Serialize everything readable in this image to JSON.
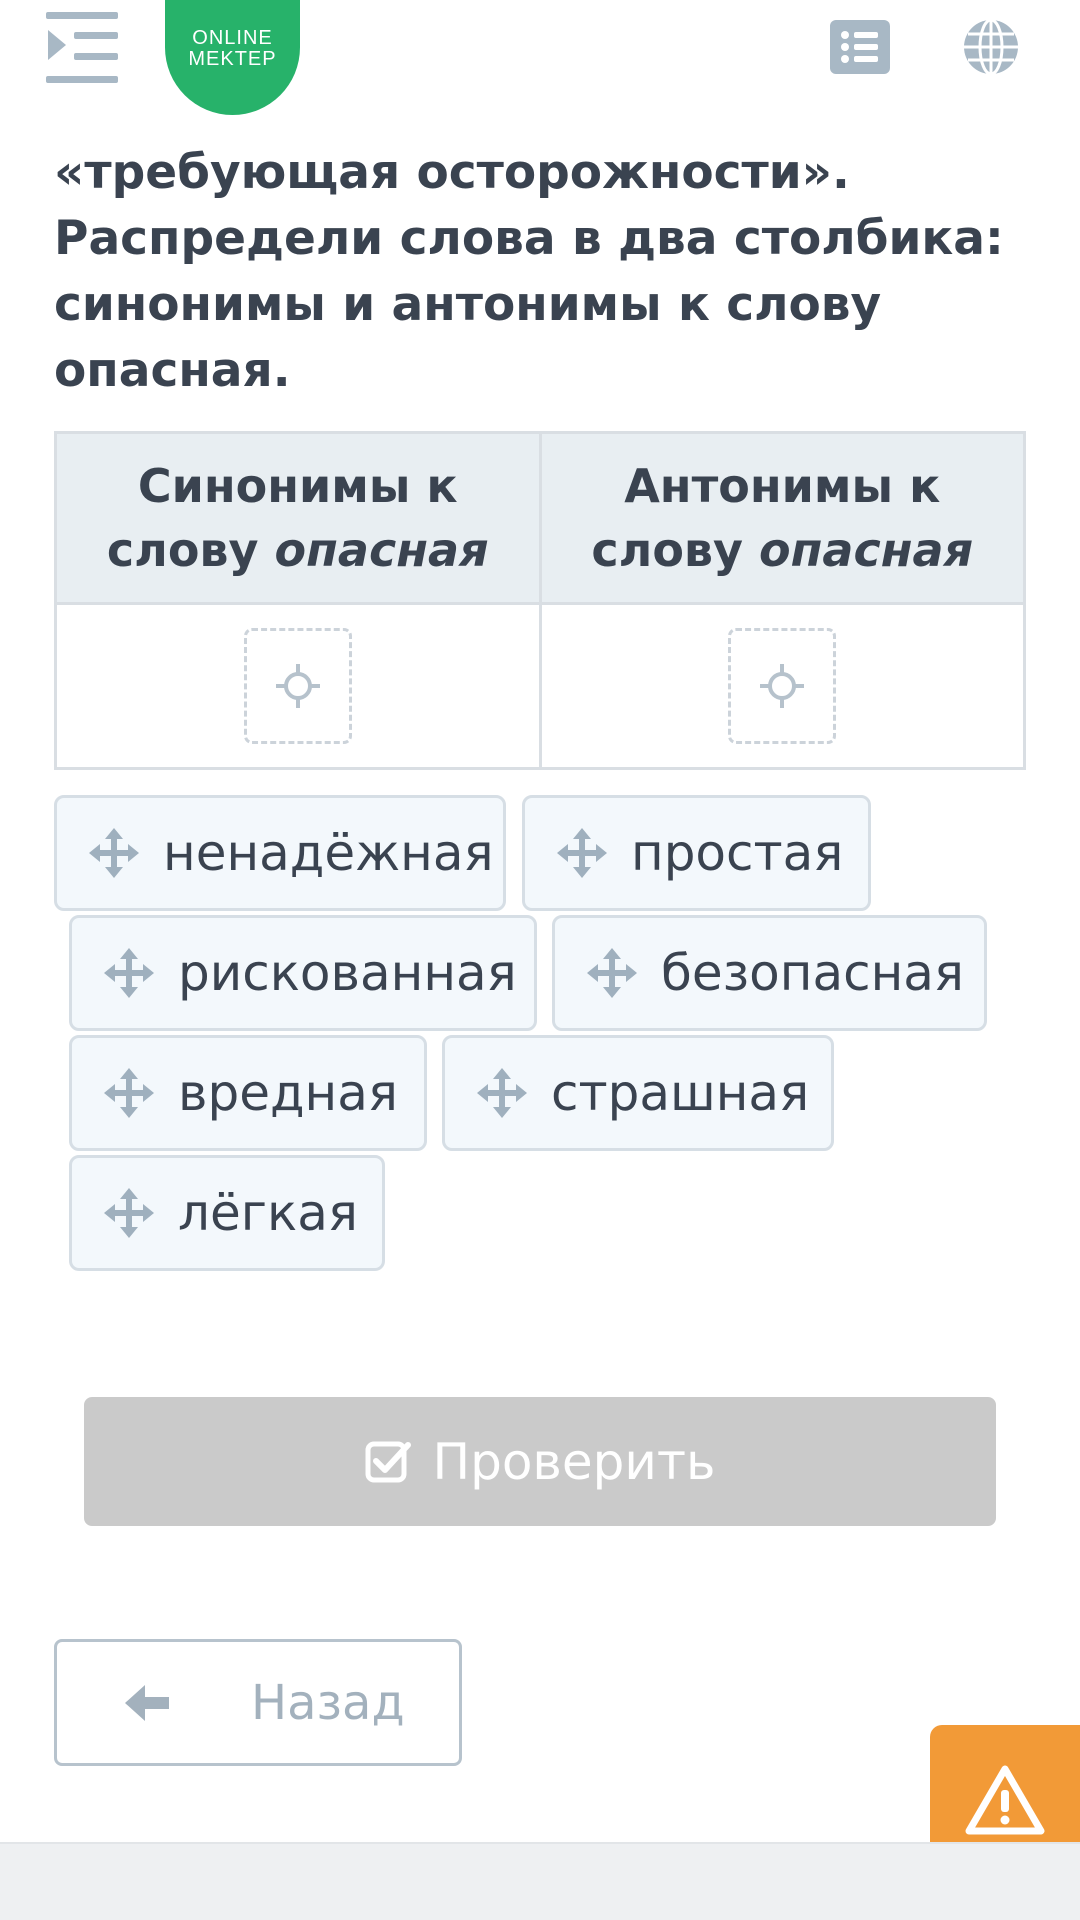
{
  "header": {
    "logo_line1": "ONLINE",
    "logo_line2": "MEKTEP",
    "colors": {
      "logo": "#27b26a",
      "icons": "#a8b8c5"
    }
  },
  "question": {
    "text": "«требующая осторожности». Распредели слова в два столбика: синонимы и антонимы к слову опасная."
  },
  "table": {
    "columns": [
      {
        "label": "Синонимы к слову ",
        "emphasis": "опасная"
      },
      {
        "label": "Антонимы к слову ",
        "emphasis": "опасная"
      }
    ]
  },
  "words": [
    "ненадёжная",
    "простая",
    "рискованная",
    "безопасная",
    "вредная",
    "страшная",
    "лёгкая"
  ],
  "actions": {
    "check_label": "Проверить",
    "back_label": "Назад"
  },
  "icons": {
    "menu": "menu-collapse-icon",
    "list": "list-icon",
    "globe": "globe-icon",
    "dropzone": "crosshair-icon",
    "chip": "move-arrows-icon",
    "check": "checkbox-icon",
    "back": "arrow-left-icon",
    "warning": "warning-triangle-icon"
  },
  "colors": {
    "check_disabled": "#cacaca",
    "warning": "#f29a37",
    "chip_bg": "#f3f8fc"
  }
}
